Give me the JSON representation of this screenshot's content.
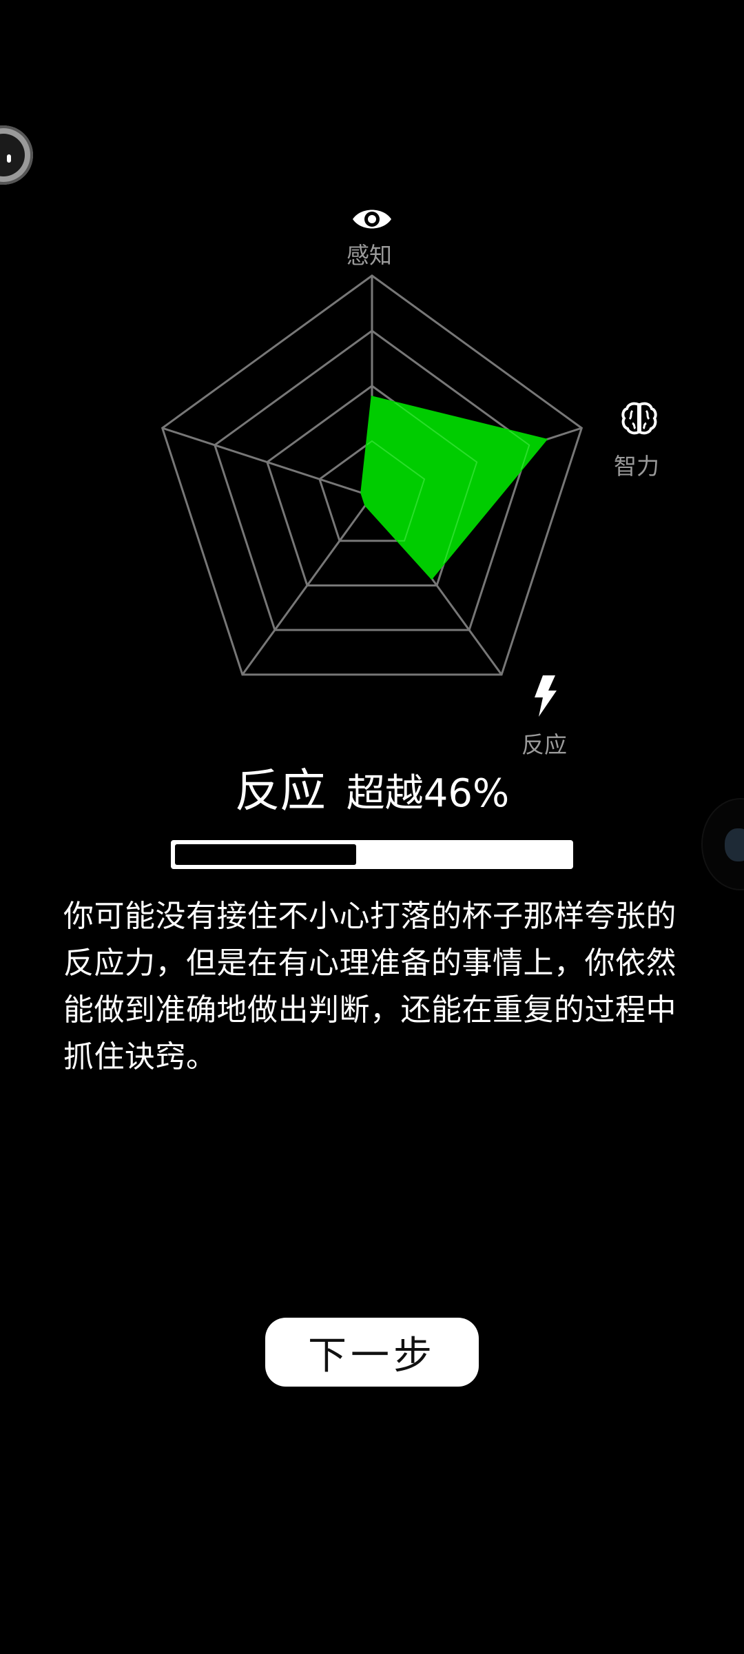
{
  "radar": {
    "axes": [
      {
        "label": "感知",
        "icon": "eye-icon"
      },
      {
        "label": "智力",
        "icon": "brain-icon"
      },
      {
        "label": "反应",
        "icon": "lightning-icon"
      }
    ],
    "levels": 4,
    "values": [
      0.45,
      0.83,
      0.46,
      0.05,
      0.05
    ],
    "fill_color": "#00cc00",
    "grid_color": "#777777"
  },
  "result": {
    "title": "反应",
    "stat": "超越46%",
    "percent": 46
  },
  "description": "你可能没有接住不小心打落的杯子那样夸张的反应力，但是在有心理准备的事情上，你依然能做到准确地做出判断，还能在重复的过程中抓住诀窍。",
  "buttons": {
    "next": "下一步"
  },
  "colors": {
    "background": "#000000",
    "text": "#ffffff",
    "muted": "#9a9a9a"
  }
}
